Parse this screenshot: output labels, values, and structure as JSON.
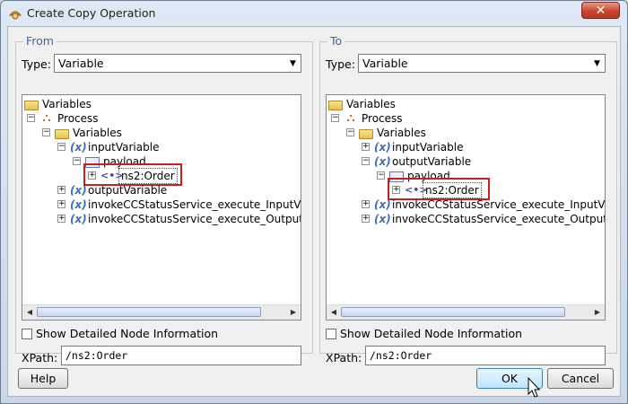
{
  "window": {
    "title": "Create Copy Operation",
    "close_label": "✕"
  },
  "from": {
    "legend": "From",
    "type_label": "Type:",
    "type_value": "Variable",
    "tree": {
      "root": "Variables",
      "process": "Process",
      "variables": "Variables",
      "input_variable": "inputVariable",
      "payload": "payload",
      "order": "ns2:Order",
      "output_variable": "outputVariable",
      "invoke_input": "invokeCCStatusService_execute_InputVa",
      "invoke_output": "invokeCCStatusService_execute_OutputV"
    },
    "show_detail_label": "Show Detailed Node Information",
    "xpath_label": "XPath:",
    "xpath_value": "/ns2:Order"
  },
  "to": {
    "legend": "To",
    "type_label": "Type:",
    "type_value": "Variable",
    "tree": {
      "root": "Variables",
      "process": "Process",
      "variables": "Variables",
      "input_variable": "inputVariable",
      "output_variable": "outputVariable",
      "payload": "payload",
      "order": "ns2:Order",
      "invoke_input": "invokeCCStatusService_execute_InputVar",
      "invoke_output": "invokeCCStatusService_execute_OutputV"
    },
    "show_detail_label": "Show Detailed Node Information",
    "xpath_label": "XPath:",
    "xpath_value": "/ns2:Order"
  },
  "buttons": {
    "help": "Help",
    "ok": "OK",
    "cancel": "Cancel"
  },
  "colors": {
    "legend": "#3c66a8",
    "highlight": "#c81e1e",
    "ok_accent": "#3c7fb1"
  }
}
